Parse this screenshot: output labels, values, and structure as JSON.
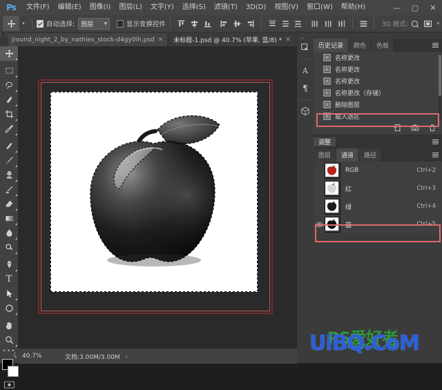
{
  "app": {
    "name": "Photoshop",
    "logo_text": "Ps"
  },
  "menubar": {
    "items": [
      {
        "label": "文件(F)"
      },
      {
        "label": "编辑(E)"
      },
      {
        "label": "图像(I)"
      },
      {
        "label": "图层(L)"
      },
      {
        "label": "文字(Y)"
      },
      {
        "label": "选择(S)"
      },
      {
        "label": "滤镜(T)"
      },
      {
        "label": "3D(D)"
      },
      {
        "label": "视图(V)"
      },
      {
        "label": "窗口(W)"
      },
      {
        "label": "帮助(H)"
      }
    ],
    "window_controls": {
      "minimize": "—",
      "maximize": "▢",
      "close": "✕"
    }
  },
  "options_bar": {
    "tool_icon": "move-tool",
    "auto_select_checked": true,
    "auto_select_label": "自动选择:",
    "target_dropdown_value": "图层",
    "show_transform_checked": false,
    "show_transform_label": "显示变换控件",
    "three_d_mode_label": "3D 模式:",
    "align_icons": [
      "align-top-edges",
      "align-vertical-centers",
      "align-bottom-edges",
      "align-left-edges",
      "align-horizontal-centers",
      "align-right-edges"
    ],
    "distribute_icons": [
      "distribute-top-edges",
      "distribute-vertical-centers",
      "distribute-bottom-edges",
      "distribute-left-edges",
      "distribute-horizontal-centers",
      "distribute-right-edges"
    ],
    "extra_icons": [
      "distribute-spacing",
      "rotate-3d-icon",
      "pan-3d-icon",
      "frame-icon"
    ]
  },
  "document_tabs": {
    "tabs": [
      {
        "label": "jround_night_2_by_nathies_stock-d4gy0ih.psd",
        "active": false,
        "close": "✕"
      },
      {
        "label": "未标题-1.psd @ 40.7% (苹果, 蓝/8) *",
        "active": true,
        "close": "✕"
      }
    ],
    "overflow": "»"
  },
  "toolbar": {
    "tools": [
      {
        "name": "move-tool",
        "glyph": "✥",
        "selected": true
      },
      {
        "name": "marquee-tool",
        "glyph": "◌",
        "selected": false
      },
      {
        "name": "lasso-tool",
        "glyph": "⌇",
        "selected": false
      },
      {
        "name": "quick-selection-tool",
        "glyph": "✨",
        "selected": false
      },
      {
        "name": "crop-tool",
        "glyph": "⌗",
        "selected": false
      },
      {
        "name": "eyedropper-tool",
        "glyph": "✒",
        "selected": false
      },
      {
        "name": "healing-brush-tool",
        "glyph": "✚",
        "selected": false
      },
      {
        "name": "brush-tool",
        "glyph": "✎",
        "selected": false
      },
      {
        "name": "clone-stamp-tool",
        "glyph": "⚗",
        "selected": false
      },
      {
        "name": "history-brush-tool",
        "glyph": "✐",
        "selected": false
      },
      {
        "name": "eraser-tool",
        "glyph": "◣",
        "selected": false
      },
      {
        "name": "gradient-tool",
        "glyph": "▭",
        "selected": false
      },
      {
        "name": "blur-tool",
        "glyph": "◐",
        "selected": false
      },
      {
        "name": "dodge-tool",
        "glyph": "○",
        "selected": false
      },
      {
        "name": "pen-tool",
        "glyph": "✑",
        "selected": false
      },
      {
        "name": "type-tool",
        "glyph": "T",
        "selected": false
      },
      {
        "name": "path-selection-tool",
        "glyph": "➤",
        "selected": false
      },
      {
        "name": "shape-tool",
        "glyph": "▢",
        "selected": false
      },
      {
        "name": "hand-tool",
        "glyph": "✋",
        "selected": false
      },
      {
        "name": "zoom-tool",
        "glyph": "🔍",
        "selected": false
      }
    ],
    "overflow": "•••",
    "foreground_color": "#000000",
    "background_color": "#ffffff",
    "quick_mask_label": "quick-mask-icon"
  },
  "canvas": {
    "image_title": "apple-grayscale-with-selection",
    "selection_active": true,
    "frame_color": "#7a2a2a"
  },
  "status_bar": {
    "zoom": "40.7%",
    "doc_size": "文档:3.00M/3.00M",
    "arrow": "›"
  },
  "icon_rail": {
    "icons": [
      {
        "name": "mini-bridge-icon",
        "glyph": "◪"
      },
      {
        "name": "character-panel-icon",
        "glyph": "A"
      },
      {
        "name": "paragraph-panel-icon",
        "glyph": "¶"
      },
      {
        "name": "3d-panel-icon",
        "glyph": "⬡"
      }
    ]
  },
  "history_panel": {
    "tabs": [
      {
        "label": "历史记录",
        "active": true
      },
      {
        "label": "颜色",
        "active": false
      },
      {
        "label": "色板",
        "active": false
      }
    ],
    "items": [
      {
        "label": "名称更改",
        "highlighted": false
      },
      {
        "label": "名称更改",
        "highlighted": false
      },
      {
        "label": "名称更改",
        "highlighted": false
      },
      {
        "label": "名称更改（存储）",
        "highlighted": false
      },
      {
        "label": "删除图层",
        "highlighted": false
      },
      {
        "label": "载入选区",
        "highlighted": true
      }
    ],
    "footer_icons": [
      {
        "name": "new-document-from-state-icon",
        "glyph": "⧉"
      },
      {
        "name": "create-snapshot-icon",
        "glyph": "▣"
      },
      {
        "name": "delete-state-icon",
        "glyph": "🗑"
      }
    ]
  },
  "adjustments_panel": {
    "title": "调整"
  },
  "channels_panel": {
    "tabs": [
      {
        "label": "图层",
        "active": false
      },
      {
        "label": "通道",
        "active": true
      },
      {
        "label": "路径",
        "active": false
      }
    ],
    "columns": [
      "channel",
      "shortcut"
    ],
    "rows": [
      {
        "name": "RGB",
        "shortcut": "Ctrl+2",
        "visible": false,
        "selected": false,
        "thumb": "color"
      },
      {
        "name": "红",
        "shortcut": "Ctrl+3",
        "visible": false,
        "selected": false,
        "thumb": "light"
      },
      {
        "name": "绿",
        "shortcut": "Ctrl+4",
        "visible": false,
        "selected": false,
        "thumb": "dark"
      },
      {
        "name": "蓝",
        "shortcut": "Ctrl+5",
        "visible": true,
        "selected": true,
        "thumb": "dark"
      }
    ],
    "eye_glyph": "👁"
  },
  "annotations": {
    "color": "#e06a6a",
    "boxes": [
      "history-load-selection",
      "channel-blue-row",
      "canvas-frame"
    ]
  },
  "watermark": {
    "main": "UiBQ.CoM",
    "green": "PS爱好者",
    "sub": "www.psahz.com"
  }
}
